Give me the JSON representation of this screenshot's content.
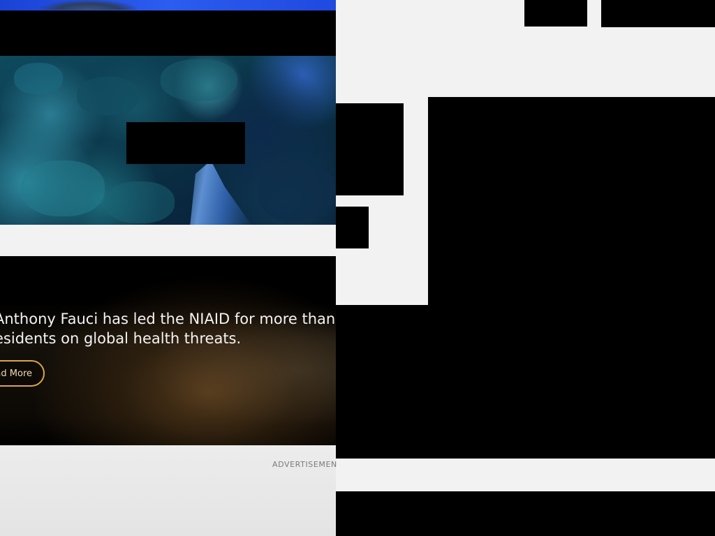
{
  "feature": {
    "text_line1": "Anthony Fauci has led the NIAID for more than",
    "text_line2": "esidents on global health threats.",
    "read_more_label": "ad More"
  },
  "advertisement": {
    "label": "ADVERTISEMEN"
  },
  "colors": {
    "button_border": "#d9a64a",
    "page_background": "#f2f2f2",
    "redaction": "#000000"
  }
}
